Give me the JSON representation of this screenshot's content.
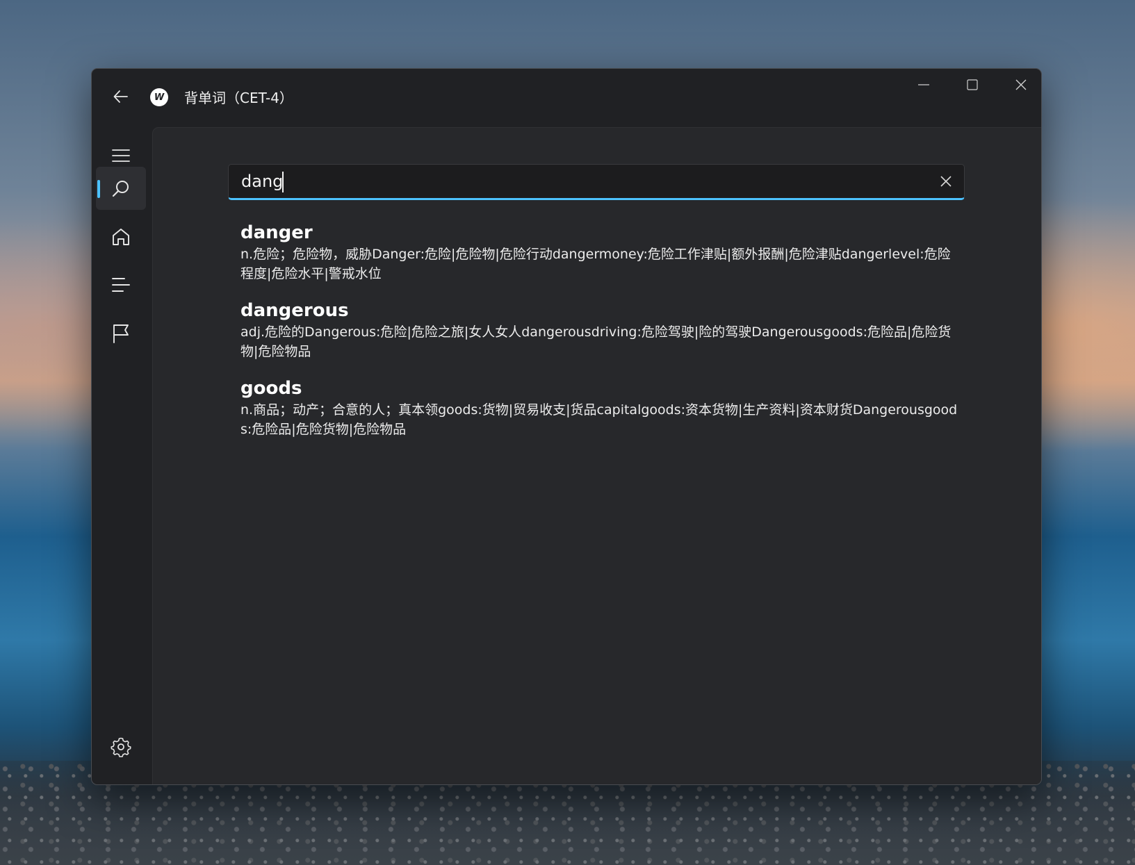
{
  "window": {
    "title": "背单词（CET-4）",
    "logo_letter": "W"
  },
  "nav": {
    "items": [
      {
        "name": "menu",
        "active": false
      },
      {
        "name": "search",
        "active": true
      },
      {
        "name": "home",
        "active": false
      },
      {
        "name": "list",
        "active": false
      },
      {
        "name": "flag",
        "active": false
      }
    ],
    "footer": [
      "settings"
    ]
  },
  "search": {
    "value": "dang",
    "placeholder": ""
  },
  "results": [
    {
      "word": "danger",
      "definition": "n.危险；危险物，威胁Danger:危险|危险物|危险行动dangermoney:危险工作津贴|额外报酬|危险津贴dangerlevel:危险程度|危险水平|警戒水位"
    },
    {
      "word": "dangerous",
      "definition": "adj.危险的Dangerous:危险|危险之旅|女人女人dangerousdriving:危险驾驶|险的驾驶Dangerousgoods:危险品|危险货物|危险物品"
    },
    {
      "word": "goods",
      "definition": "n.商品；动产；合意的人；真本领goods:货物|贸易收支|货品capitalgoods:资本货物|生产资料|资本财货Dangerousgoods:危险品|危险货物|危险物品"
    }
  ],
  "colors": {
    "accent": "#4cc2ff",
    "window_bg": "#202124",
    "content_bg": "#27282b"
  }
}
